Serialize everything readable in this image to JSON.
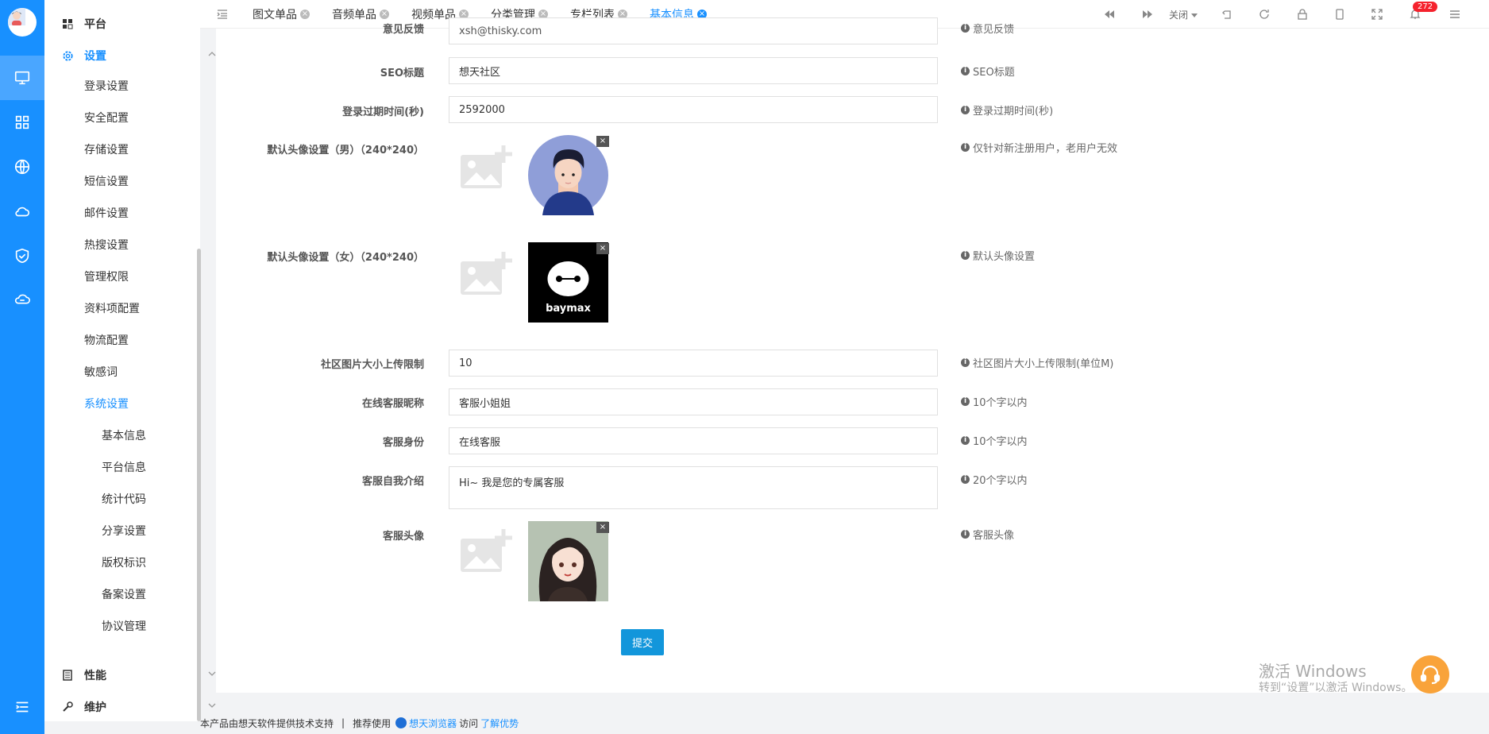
{
  "sidebar": {
    "groups": [
      {
        "label": "平台"
      },
      {
        "label": "设置"
      },
      {
        "label": "性能"
      },
      {
        "label": "维护"
      }
    ],
    "items": [
      {
        "label": "登录设置"
      },
      {
        "label": "安全配置"
      },
      {
        "label": "存储设置"
      },
      {
        "label": "短信设置"
      },
      {
        "label": "邮件设置"
      },
      {
        "label": "热搜设置"
      },
      {
        "label": "管理权限"
      },
      {
        "label": "资料项配置"
      },
      {
        "label": "物流配置"
      },
      {
        "label": "敏感词"
      },
      {
        "label": "系统设置"
      }
    ],
    "sub_items": [
      {
        "label": "基本信息"
      },
      {
        "label": "平台信息"
      },
      {
        "label": "统计代码"
      },
      {
        "label": "分享设置"
      },
      {
        "label": "版权标识"
      },
      {
        "label": "备案设置"
      },
      {
        "label": "协议管理"
      }
    ]
  },
  "tabs": [
    {
      "label": "图文单品"
    },
    {
      "label": "音频单品"
    },
    {
      "label": "视频单品"
    },
    {
      "label": "分类管理"
    },
    {
      "label": "专栏列表"
    },
    {
      "label": "基本信息"
    }
  ],
  "toolbar": {
    "close_label": "关闭",
    "badge": "272"
  },
  "form": {
    "top_partial": {
      "label": "意见反馈",
      "value": "xsh@thisky.com",
      "hint": "意见反馈"
    },
    "seo": {
      "label": "SEO标题",
      "value": "想天社区",
      "hint": "SEO标题"
    },
    "expire": {
      "label": "登录过期时间(秒)",
      "value": "2592000",
      "hint": "登录过期时间(秒)"
    },
    "avatar_male": {
      "label": "默认头像设置（男）（240*240）",
      "hint": "仅针对新注册用户，老用户无效"
    },
    "avatar_female": {
      "label": "默认头像设置（女）（240*240）",
      "hint": "默认头像设置",
      "logo_text": "baymax"
    },
    "img_limit": {
      "label": "社区图片大小上传限制",
      "value": "10",
      "hint": "社区图片大小上传限制(单位M)"
    },
    "nickname": {
      "label": "在线客服昵称",
      "value": "客服小姐姐",
      "hint": "10个字以内"
    },
    "identity": {
      "label": "客服身份",
      "value": "在线客服",
      "hint": "10个字以内"
    },
    "intro": {
      "label": "客服自我介绍",
      "value": "Hi~ 我是您的专属客服",
      "hint": "20个字以内"
    },
    "service_avatar": {
      "label": "客服头像",
      "hint": "客服头像"
    },
    "submit": "提交"
  },
  "footer": {
    "text1": "本产品由想天软件提供技术支持",
    "sep": "|",
    "text2": "推荐使用",
    "browser": "想天浏览器",
    "text3": "访问",
    "link": "了解优势"
  },
  "watermark": {
    "line1": "激活 Windows",
    "line2": "转到“设置”以激活 Windows。"
  },
  "colors": {
    "primary": "#1890ff",
    "submit": "#1296db",
    "badge": "#f5222d"
  }
}
